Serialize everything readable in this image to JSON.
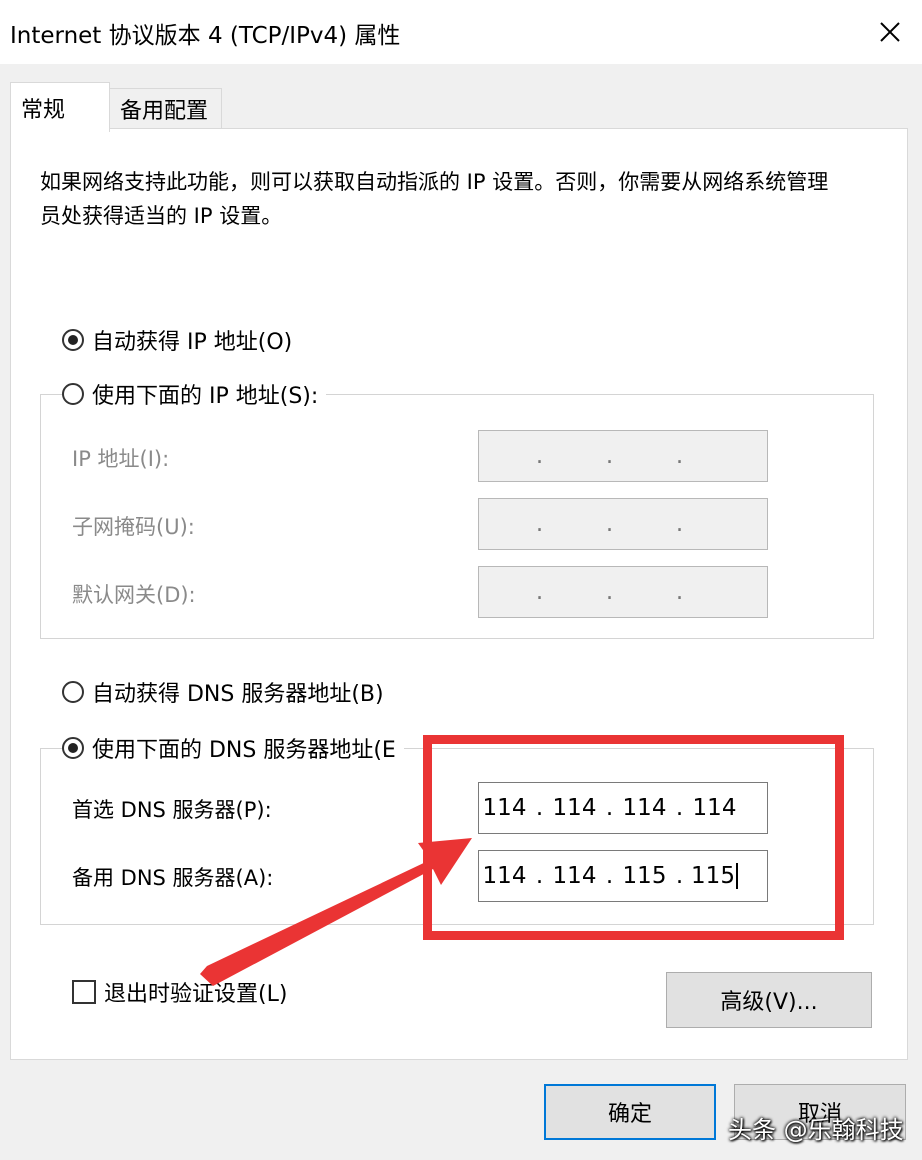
{
  "window": {
    "title": "Internet 协议版本 4 (TCP/IPv4) 属性",
    "close_icon": "close-icon"
  },
  "tabs": [
    {
      "label": "常规",
      "active": true
    },
    {
      "label": "备用配置",
      "active": false
    }
  ],
  "general": {
    "description": "如果网络支持此功能，则可以获取自动指派的 IP 设置。否则，你需要从网络系统管理员处获得适当的 IP 设置。",
    "ip_auto": {
      "label": "自动获得 IP 地址(O)",
      "checked": true
    },
    "ip_manual": {
      "label": "使用下面的 IP 地址(S):",
      "checked": false,
      "fields": {
        "ip": {
          "label": "IP 地址(I):",
          "value": [
            "",
            "",
            "",
            ""
          ]
        },
        "mask": {
          "label": "子网掩码(U):",
          "value": [
            "",
            "",
            "",
            ""
          ]
        },
        "gateway": {
          "label": "默认网关(D):",
          "value": [
            "",
            "",
            "",
            ""
          ]
        }
      }
    },
    "dns_auto": {
      "label": "自动获得 DNS 服务器地址(B)",
      "checked": false
    },
    "dns_manual": {
      "label": "使用下面的 DNS 服务器地址(E",
      "checked": true,
      "fields": {
        "preferred": {
          "label": "首选 DNS 服务器(P):",
          "value": [
            "114",
            "114",
            "114",
            "114"
          ]
        },
        "alternate": {
          "label": "备用 DNS 服务器(A):",
          "value": [
            "114",
            "114",
            "115",
            "115"
          ]
        }
      }
    },
    "validate": {
      "label": "退出时验证设置(L)",
      "checked": false
    },
    "advanced_label": "高级(V)..."
  },
  "buttons": {
    "ok": "确定",
    "cancel": "取消"
  },
  "annotation": {
    "color": "#ea3434"
  },
  "watermark": "头条 @乐翰科技",
  "colors": {
    "focus_border": "#0078d7",
    "annotation_red": "#ea3434",
    "dialog_bg": "#f0f0f0"
  }
}
